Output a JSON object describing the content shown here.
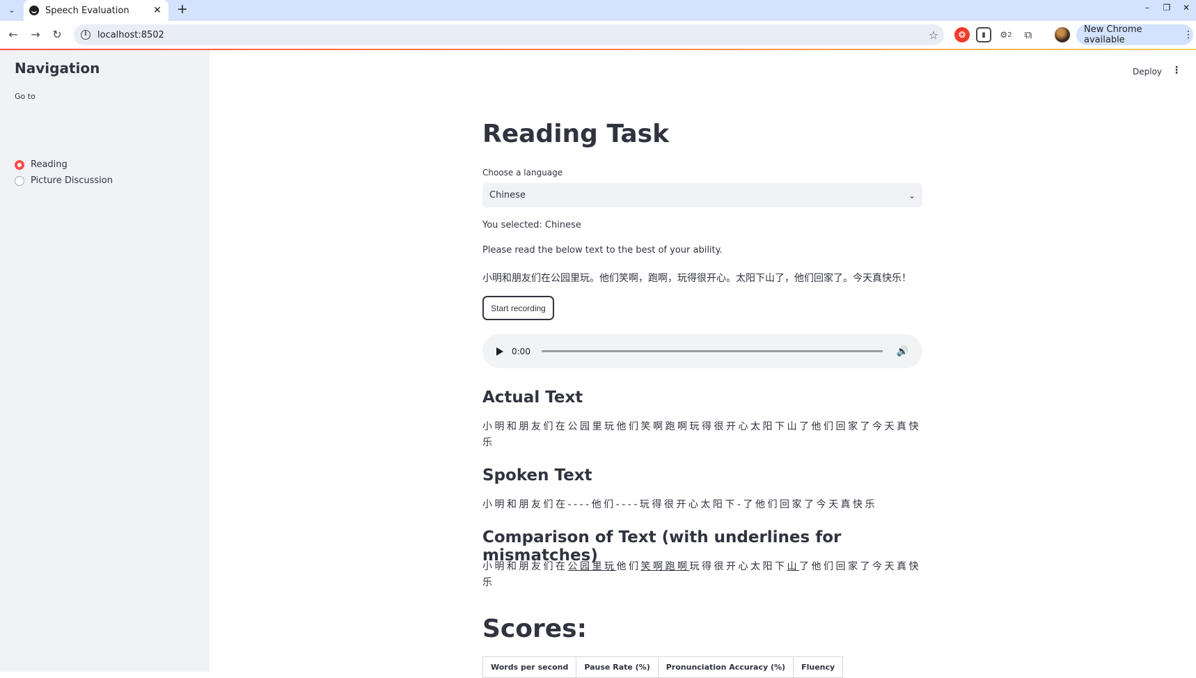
{
  "browser": {
    "tab_title": "Speech Evaluation",
    "url": "localhost:8502",
    "new_chrome_label": "New Chrome available",
    "extension_badge": "2"
  },
  "sidebar": {
    "title": "Navigation",
    "goto_label": "Go to",
    "options": [
      {
        "label": "Reading",
        "selected": true
      },
      {
        "label": "Picture Discussion",
        "selected": false
      }
    ]
  },
  "header": {
    "deploy_label": "Deploy"
  },
  "main": {
    "title": "Reading Task",
    "language_label": "Choose a language",
    "language_value": "Chinese",
    "selected_text": "You selected: Chinese",
    "instructions": "Please read the below text to the best of your ability.",
    "reading_text": "小明和朋友们在公园里玩。他们笑啊，跑啊，玩得很开心。太阳下山了，他们回家了。今天真快乐！",
    "record_button": "Start recording",
    "audio_time": "0:00",
    "actual_heading": "Actual Text",
    "actual_text": "小明和朋友们在公园里玩他们笑啊跑啊玩得很开心太阳下山了他们回家了今天真快乐",
    "spoken_heading": "Spoken Text",
    "spoken_text": "小明和朋友们在----他们----玩得很开心太阳下-了他们回家了今天真快乐",
    "comparison_heading": "Comparison of Text (with underlines for mismatches)",
    "comparison_parts": [
      {
        "text": "小明和朋友们在",
        "mismatch": false
      },
      {
        "text": "公园里玩",
        "mismatch": true
      },
      {
        "text": "他们",
        "mismatch": false
      },
      {
        "text": "笑啊跑啊",
        "mismatch": true
      },
      {
        "text": "玩得很开心太阳下",
        "mismatch": false
      },
      {
        "text": "山",
        "mismatch": true
      },
      {
        "text": "了他们回家了今天真快乐",
        "mismatch": false
      }
    ],
    "scores_heading": "Scores:",
    "score_columns": [
      "Words per second",
      "Pause Rate (%)",
      "Pronunciation Accuracy (%)",
      "Fluency"
    ]
  },
  "colors": {
    "accent": "#ff4b4b",
    "sidebar_bg": "#f0f2f6",
    "text": "#31333f"
  }
}
